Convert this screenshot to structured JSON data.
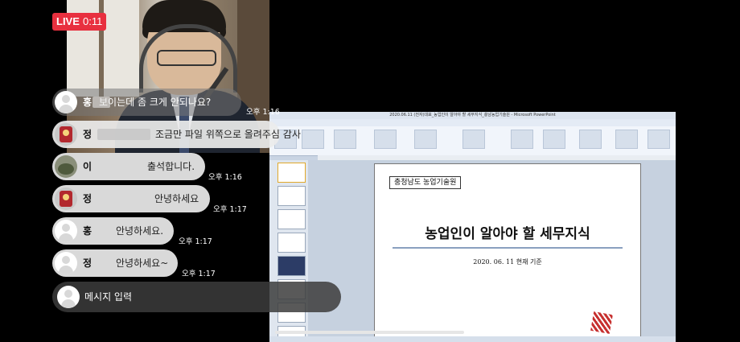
{
  "live": {
    "label": "LIVE",
    "time": "0:11"
  },
  "chat": {
    "messages": [
      {
        "name": "홍",
        "text": "보이는데 좀 크게 안되나요?",
        "time": "오후 1:16",
        "avatar": "default"
      },
      {
        "name": "정",
        "text": "조금만 파일 위쪽으로 올려주심 감사",
        "time": "",
        "avatar": "flag"
      },
      {
        "name": "이",
        "text": "출석합니다.",
        "time": "오후 1:16",
        "avatar": "photo"
      },
      {
        "name": "정",
        "text": "안녕하세요",
        "time": "오후 1:17",
        "avatar": "flag"
      },
      {
        "name": "홍",
        "text": "안녕하세요.",
        "time": "오후 1:17",
        "avatar": "default"
      },
      {
        "name": "정",
        "text": "안녕하세요~",
        "time": "오후 1:17",
        "avatar": "default"
      }
    ],
    "input_placeholder": "메시지 입력"
  },
  "screen_share": {
    "window_title": "2020.06.11 (전자)대표_농업인이 알아야 할 세무지식_충남농업기술원 - Microsoft PowerPoint",
    "slide": {
      "org": "충청남도 농업기술원",
      "title": "농업인이 알아야 할 세무지식",
      "date": "2020. 06. 11 현재 기준"
    }
  },
  "colors": {
    "live_red": "#e8303f",
    "bubble_light": "#ebebeb"
  },
  "icons": [
    "avatar-default-icon",
    "avatar-flag-icon",
    "avatar-photo-icon",
    "logo-icon"
  ]
}
